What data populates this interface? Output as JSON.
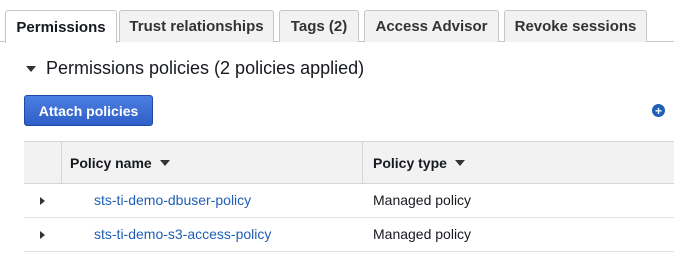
{
  "tabs": [
    {
      "label": "Permissions",
      "active": true
    },
    {
      "label": "Trust relationships",
      "active": false
    },
    {
      "label": "Tags (2)",
      "active": false
    },
    {
      "label": "Access Advisor",
      "active": false
    },
    {
      "label": "Revoke sessions",
      "active": false
    }
  ],
  "section": {
    "title": "Permissions policies (2 policies applied)",
    "attach_label": "Attach policies"
  },
  "table": {
    "columns": [
      "Policy name",
      "Policy type"
    ],
    "rows": [
      {
        "name": "sts-ti-demo-dbuser-policy",
        "type": "Managed policy"
      },
      {
        "name": "sts-ti-demo-s3-access-policy",
        "type": "Managed policy"
      }
    ]
  },
  "colors": {
    "link": "#1f5fb5",
    "primary_button": "#2e5fc9"
  },
  "icons": [
    "caret-down-icon",
    "add-circle-icon",
    "expand-row-icon",
    "sort-caret-icon"
  ]
}
